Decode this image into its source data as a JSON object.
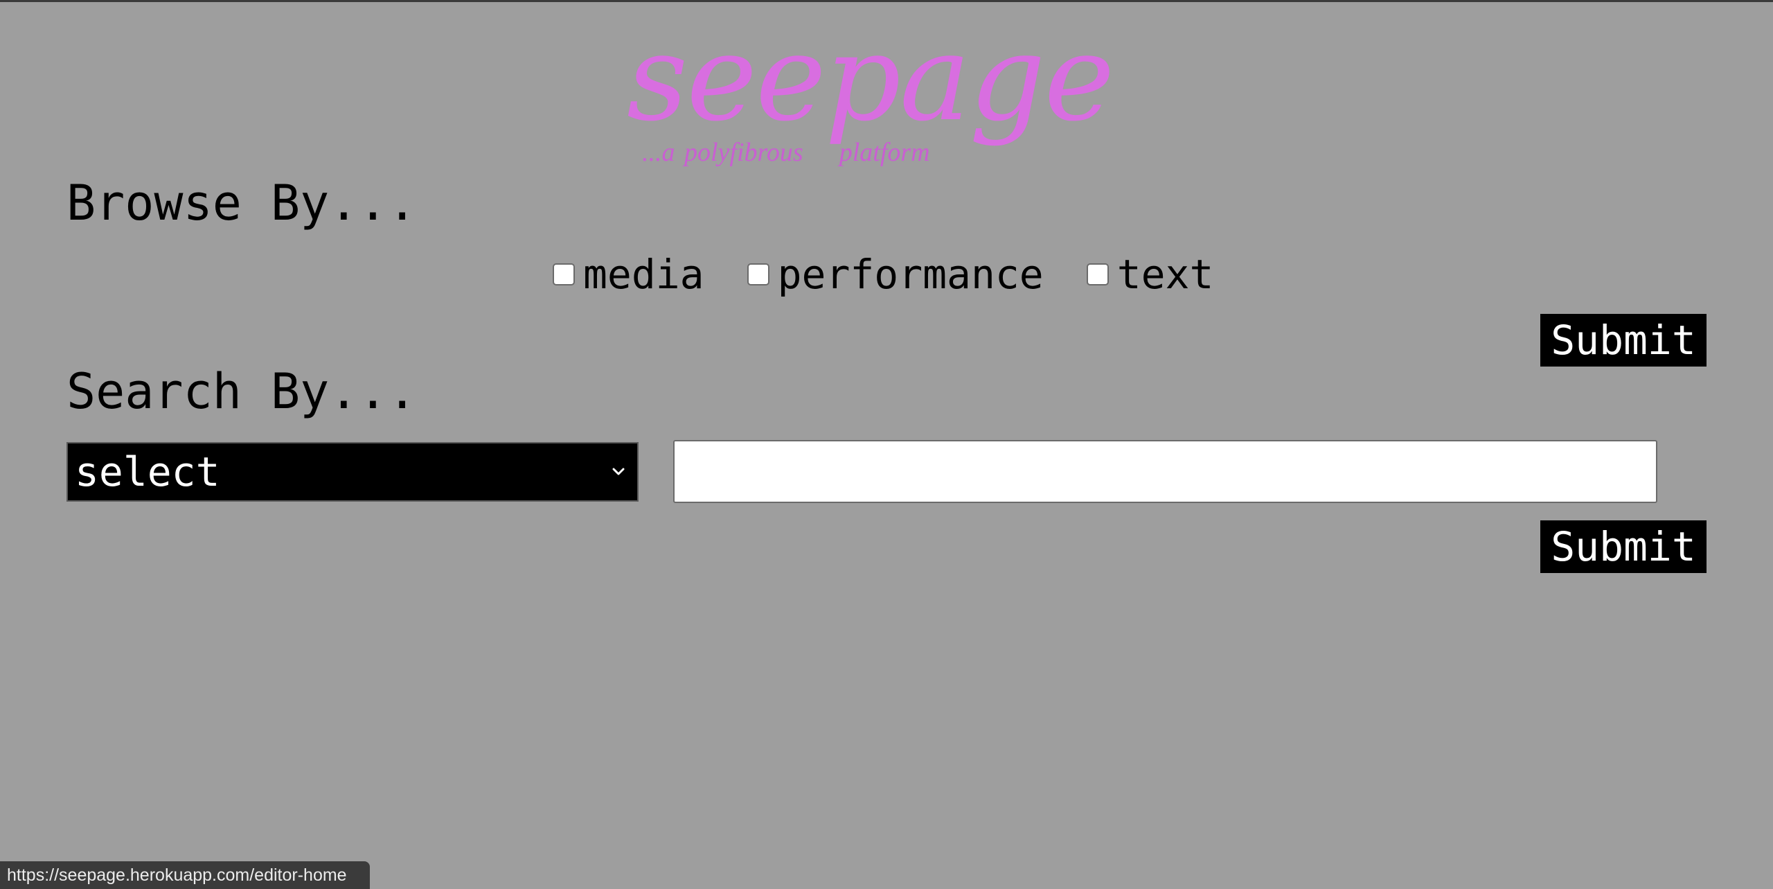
{
  "logo": {
    "word": "seepage",
    "tagline_part1": "...a polyfibrous",
    "tagline_part2": "platform"
  },
  "browse": {
    "heading": "Browse By...",
    "options": [
      {
        "label": "media",
        "checked": false
      },
      {
        "label": "performance",
        "checked": false
      },
      {
        "label": "text",
        "checked": false
      }
    ],
    "submit_label": "Submit"
  },
  "search": {
    "heading": "Search By...",
    "select_value": "select",
    "input_value": "",
    "submit_label": "Submit"
  },
  "status_bar": {
    "url": "https://seepage.herokuapp.com/editor-home"
  },
  "colors": {
    "background": "#9e9e9e",
    "logo": "#d86ee0",
    "button_bg": "#000000",
    "button_text": "#ffffff"
  }
}
